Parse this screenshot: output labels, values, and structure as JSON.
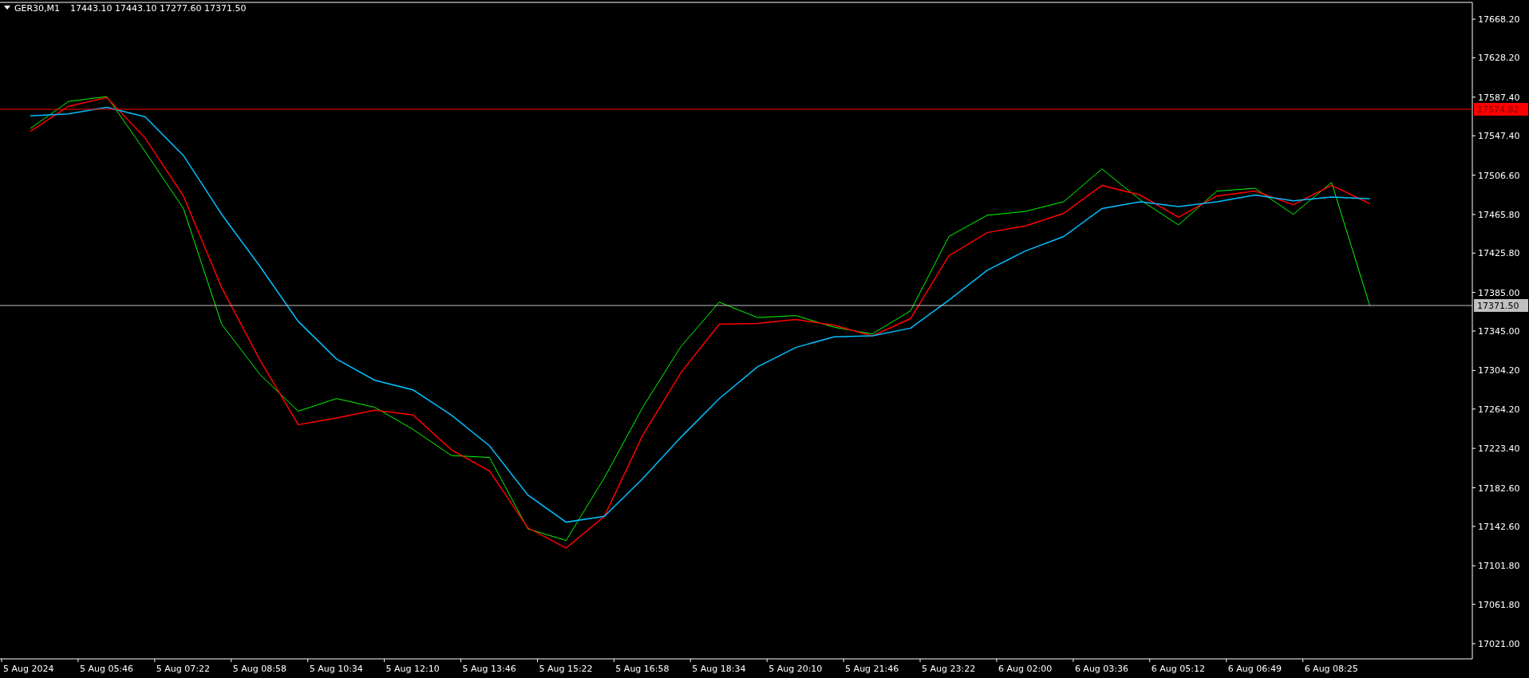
{
  "header": {
    "symbol": "GER30,M1",
    "ohlc": "17443.10 17443.10 17277.60 17371.50"
  },
  "chart": {
    "chart_data": {
      "type": "line",
      "categories": [
        "5 Aug 2024",
        null,
        "5 Aug 05:46",
        null,
        "5 Aug 07:22",
        null,
        "5 Aug 08:58",
        null,
        "5 Aug 10:34",
        null,
        "5 Aug 12:10",
        null,
        "5 Aug 13:46",
        null,
        "5 Aug 15:22",
        null,
        "5 Aug 16:58",
        null,
        "5 Aug 18:34",
        null,
        "5 Aug 20:10",
        null,
        "5 Aug 21:46",
        null,
        "5 Aug 23:22",
        null,
        "6 Aug 02:00",
        null,
        "6 Aug 03:36",
        null,
        "6 Aug 05:12",
        null,
        "6 Aug 06:49",
        null,
        "6 Aug 08:25",
        null
      ],
      "series": [
        {
          "color": "#00ff00",
          "values": [
            17555,
            17583,
            17588,
            17531,
            17472,
            17352,
            17300,
            17262,
            17275,
            17266,
            17243,
            17216,
            17214,
            17140,
            17128,
            17193,
            17266,
            17329,
            17375,
            17359,
            17361,
            17349,
            17342,
            17366,
            17443,
            17465,
            17469,
            17479,
            17513,
            17481,
            17455,
            17490,
            17493,
            17466,
            17499,
            17371
          ]
        },
        {
          "color": "#ff0000",
          "values": [
            17552,
            17578,
            17587,
            17545,
            17485,
            17390,
            17315,
            17248,
            17255,
            17263,
            17258,
            17222,
            17200,
            17141,
            17120,
            17153,
            17237,
            17302,
            17352,
            17353,
            17357,
            17351,
            17340,
            17358,
            17423,
            17447,
            17454,
            17467,
            17496,
            17486,
            17463,
            17485,
            17490,
            17476,
            17496,
            17477
          ]
        },
        {
          "color": "#00bfff",
          "values": [
            17568,
            17570,
            17577,
            17567,
            17527,
            17466,
            17412,
            17355,
            17316,
            17294,
            17284,
            17258,
            17226,
            17175,
            17147,
            17153,
            17192,
            17235,
            17275,
            17308,
            17328,
            17339,
            17340,
            17348,
            17377,
            17408,
            17428,
            17443,
            17472,
            17479,
            17474,
            17479,
            17486,
            17480,
            17484,
            17482
          ]
        }
      ],
      "ylim": [
        17005.3,
        17685.6
      ],
      "yticks": [
        {
          "value": 17668.2,
          "label": "17668.20"
        },
        {
          "value": 17628.2,
          "label": "17628.20"
        },
        {
          "value": 17587.4,
          "label": "17587.40"
        },
        {
          "value": 17547.4,
          "label": "17547.40"
        },
        {
          "value": 17506.6,
          "label": "17506.60"
        },
        {
          "value": 17465.8,
          "label": "17465.80"
        },
        {
          "value": 17425.8,
          "label": "17425.80"
        },
        {
          "value": 17385.0,
          "label": "17385.00"
        },
        {
          "value": 17345.0,
          "label": "17345.00"
        },
        {
          "value": 17304.2,
          "label": "17304.20"
        },
        {
          "value": 17264.2,
          "label": "17264.20"
        },
        {
          "value": 17223.4,
          "label": "17223.40"
        },
        {
          "value": 17182.6,
          "label": "17182.60"
        },
        {
          "value": 17142.6,
          "label": "17142.60"
        },
        {
          "value": 17101.8,
          "label": "17101.80"
        },
        {
          "value": 17061.8,
          "label": "17061.80"
        },
        {
          "value": 17021.0,
          "label": "17021.00"
        }
      ],
      "ref_lines": [
        {
          "axis": "y",
          "value": 17574.82,
          "label": "17574.82",
          "color": "#ff0000"
        },
        {
          "axis": "y",
          "value": 17371.5,
          "label": "17371.50",
          "color": "#c0c0c0"
        }
      ]
    }
  }
}
